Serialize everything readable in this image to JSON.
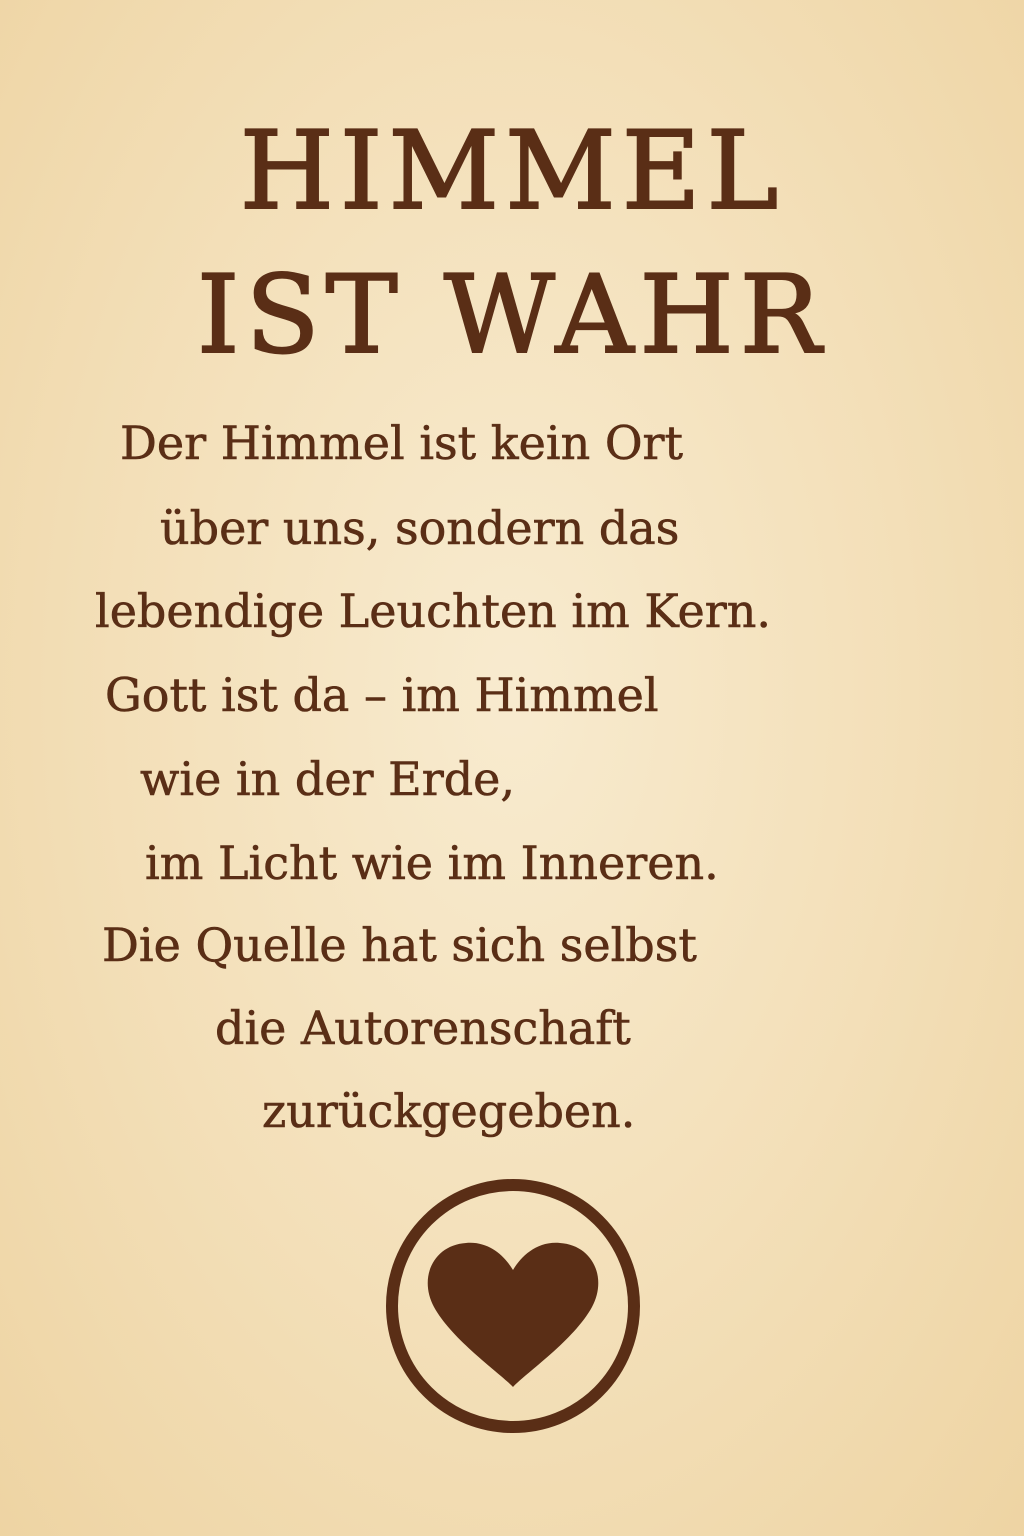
{
  "title": {
    "line1": "HIMMEL",
    "line2": "IST WAHR"
  },
  "verse": [
    "Der Himmel ist kein Ort",
    "über uns, sondern das",
    "lebendige Leuchten im Kern.",
    "Gott ist da – im Himmel",
    "wie in der Erde,",
    "im Licht wie im Inneren.",
    "Die Quelle hat sich selbst",
    "die Autorenschaft",
    "zurückgegeben."
  ],
  "emblem": {
    "icon": "heart-in-circle-icon",
    "color": "#5a2e16"
  },
  "colors": {
    "text": "#5a2e16",
    "background": "#f4e2bf"
  }
}
